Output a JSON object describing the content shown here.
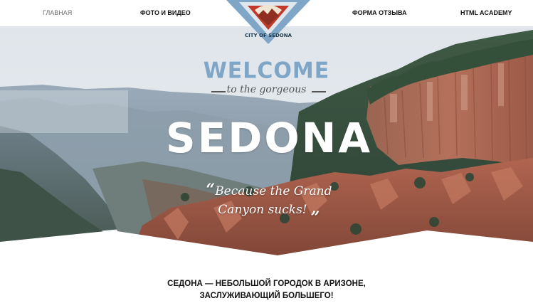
{
  "nav": {
    "items": [
      {
        "label": "ГЛАВНАЯ"
      },
      {
        "label": "ФОТО И ВИДЕО"
      },
      {
        "label": "ФОРМА ОТЗЫВА"
      },
      {
        "label": "HTML ACADEMY"
      }
    ]
  },
  "logo": {
    "text": "CITY OF SEDONA",
    "accent_color": "#7fa6c7",
    "emblem_color": "#c0392b"
  },
  "hero": {
    "welcome": "WELCOME",
    "tagline": "to the gorgeous",
    "title": "SEDONA",
    "quote_line1": "Because the Grand",
    "quote_line2": "Canyon sucks!",
    "quote_open": "“",
    "quote_close": "„"
  },
  "intro": {
    "line1": "СЕДОНА — НЕБОЛЬШОЙ ГОРОДОК В АРИЗОНЕ,",
    "line2": "ЗАСЛУЖИВАЮЩИЙ БОЛЬШЕГО!"
  }
}
